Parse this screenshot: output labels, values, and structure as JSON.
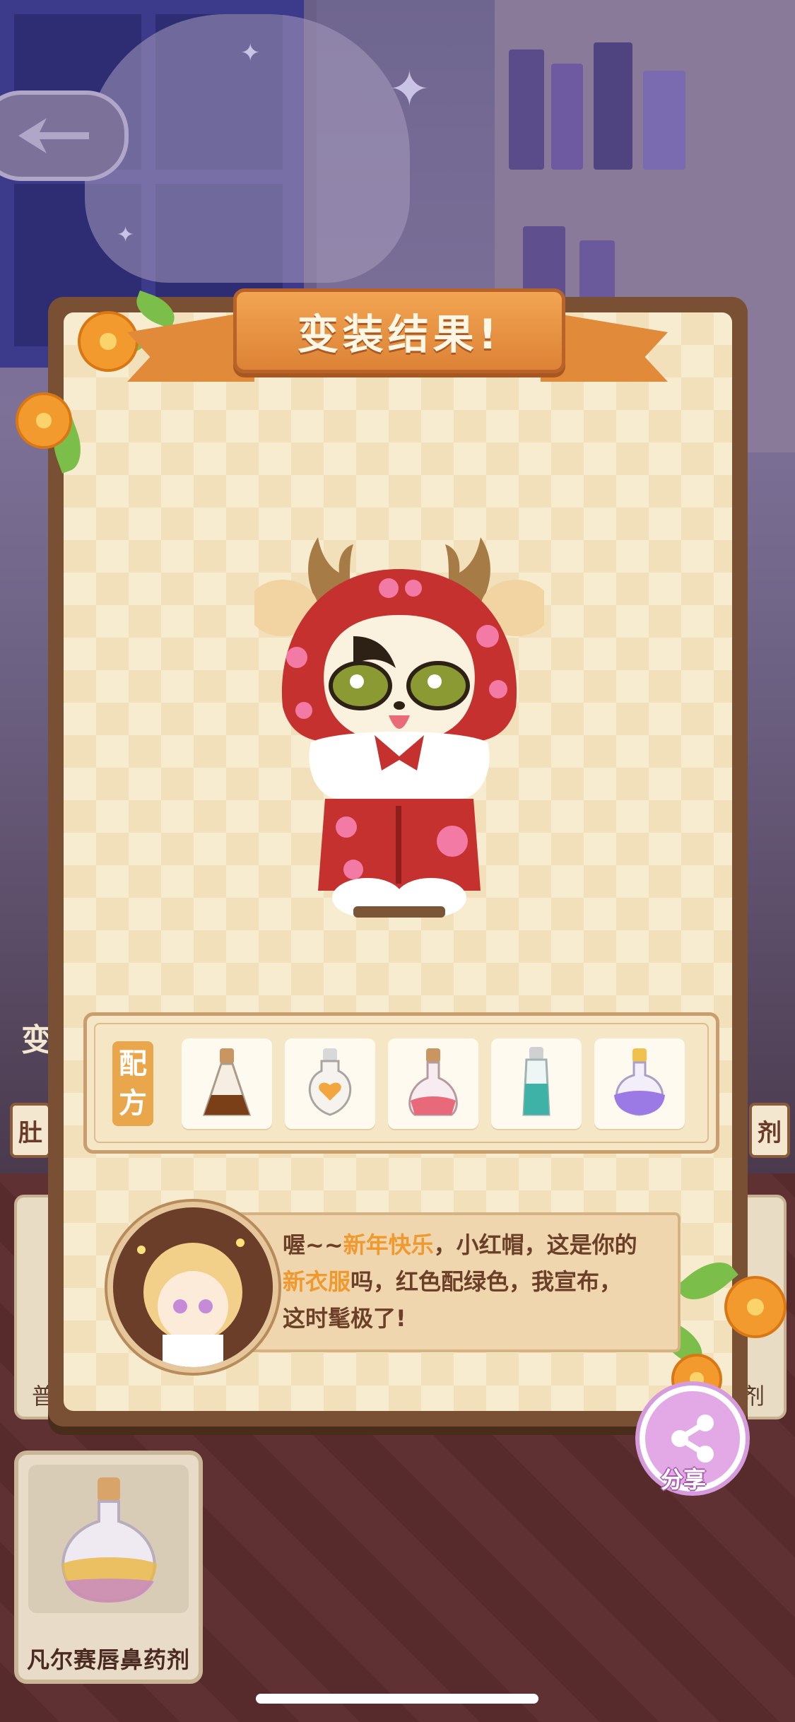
{
  "panel": {
    "title": "变装结果!"
  },
  "recipe": {
    "tag_top": "配",
    "tag_bottom": "方",
    "potions": [
      {
        "icon": "brown-potion-icon",
        "color": "#7a3f17"
      },
      {
        "icon": "orange-heart-potion-icon",
        "color": "#f3a640"
      },
      {
        "icon": "pink-potion-icon",
        "color": "#e86a7a"
      },
      {
        "icon": "teal-potion-icon",
        "color": "#3fb2a8"
      },
      {
        "icon": "purple-potion-icon",
        "color": "#9b7ae6"
      }
    ]
  },
  "dialog": {
    "part1": "喔~~",
    "highlight1": "新年快乐",
    "part2": "，小红帽，这是你的",
    "highlight2": "新衣服",
    "part3": "吗，红色配绿色，我宣布，",
    "part4": "这时髦极了!"
  },
  "share": {
    "label": "分享"
  },
  "background": {
    "left_tab": "肚",
    "right_tab": "剂",
    "left_side_label": "变",
    "left_strip_label": "普",
    "right_strip_label": "剂",
    "potion_card_label": "凡尔赛唇鼻药剂"
  },
  "colors": {
    "ribbon": "#e08a3a",
    "panel_frame": "#7a5034",
    "highlight_text": "#f0992e",
    "share_button": "#e3a8e6"
  }
}
